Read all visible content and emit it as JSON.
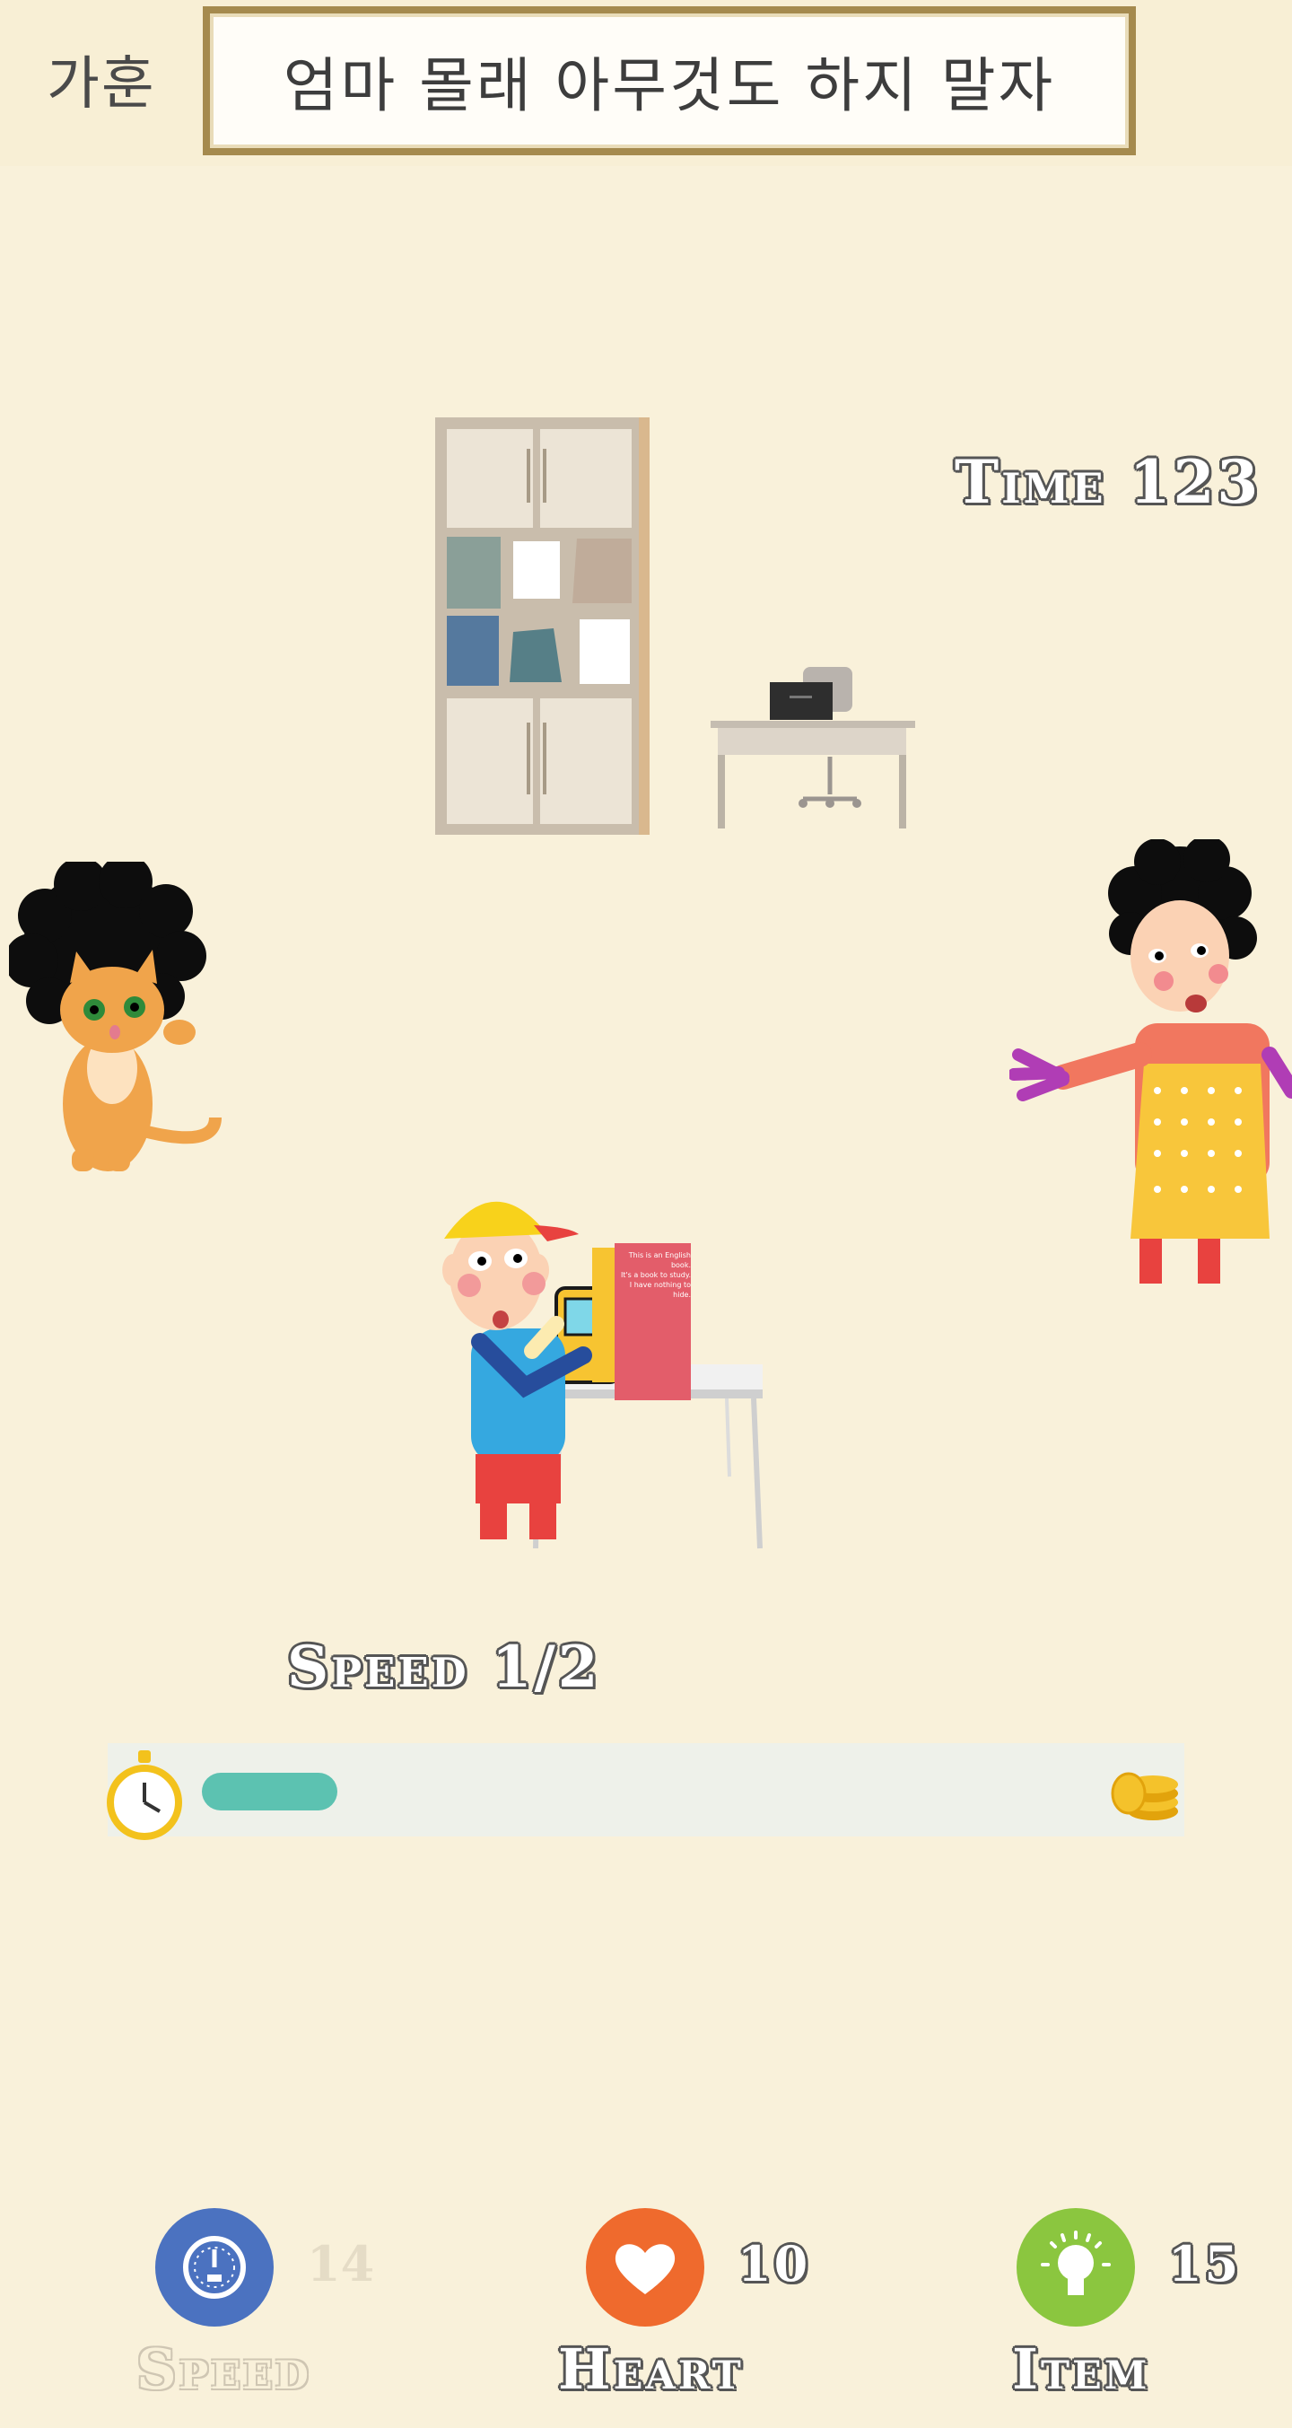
{
  "header": {
    "motto_label": "가훈",
    "motto_text": "엄마 몰래 아무것도 하지 말자"
  },
  "game": {
    "time_text": "Time 123",
    "speed_text": "Speed 1/2",
    "progress_fraction": 0.14
  },
  "stats": {
    "speed": {
      "count": "14",
      "label": "Speed",
      "icon": "speedometer-icon",
      "color": "#4b72c0",
      "active": false
    },
    "heart": {
      "count": "10",
      "label": "Heart",
      "icon": "heart-icon",
      "color": "#ef6a2d",
      "active": true
    },
    "item": {
      "count": "15",
      "label": "Item",
      "icon": "lightbulb-icon",
      "color": "#8bc63f",
      "active": true
    }
  },
  "book": {
    "lines": [
      "This is an English book.",
      "It's a book to study.",
      "I have nothing to hide."
    ]
  },
  "colors": {
    "background": "#f9f1da",
    "frame": "#a58a4e",
    "progress": "#5cc2b1"
  }
}
